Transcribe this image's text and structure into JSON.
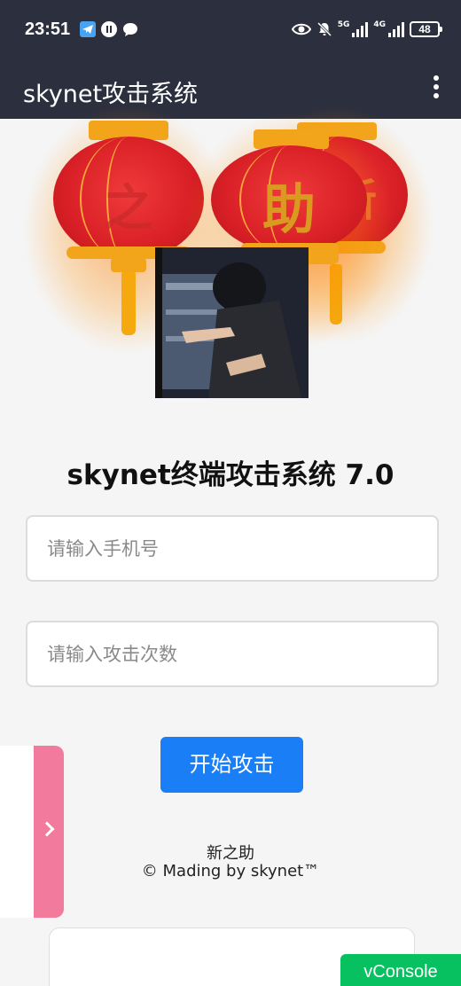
{
  "status_bar": {
    "time": "23:51",
    "network_a": "5G",
    "network_b": "4G",
    "battery": "48",
    "icons": [
      "telegram-icon",
      "app-icon",
      "chat-bubble-icon",
      "eye-icon",
      "bell-muted-icon",
      "signal-icon",
      "signal-icon",
      "battery-icon"
    ]
  },
  "app_bar": {
    "title": "skynet攻击系统",
    "menu_icon": "more-vert-icon"
  },
  "banner": {
    "lanterns": [
      {
        "char": "之"
      },
      {
        "char": "助"
      },
      {
        "char": "新"
      }
    ]
  },
  "main": {
    "heading": "skynet终端攻击系统 7.0",
    "phone_input": {
      "placeholder": "请输入手机号",
      "value": ""
    },
    "count_input": {
      "placeholder": "请输入攻击次数",
      "value": ""
    },
    "start_button": "开始攻击",
    "footer_line1": "新之助",
    "footer_line2": "© Mading by skynet™"
  },
  "floating": {
    "side_tab_icon": "chevron-right-icon",
    "vconsole_label": "vConsole"
  },
  "colors": {
    "app_bar_bg": "#2c2f3e",
    "primary_button": "#1a7ef7",
    "side_tab": "#f27a9c",
    "vconsole": "#07c160",
    "lantern_red": "#d81f26",
    "lantern_gold": "#f2a51a"
  }
}
